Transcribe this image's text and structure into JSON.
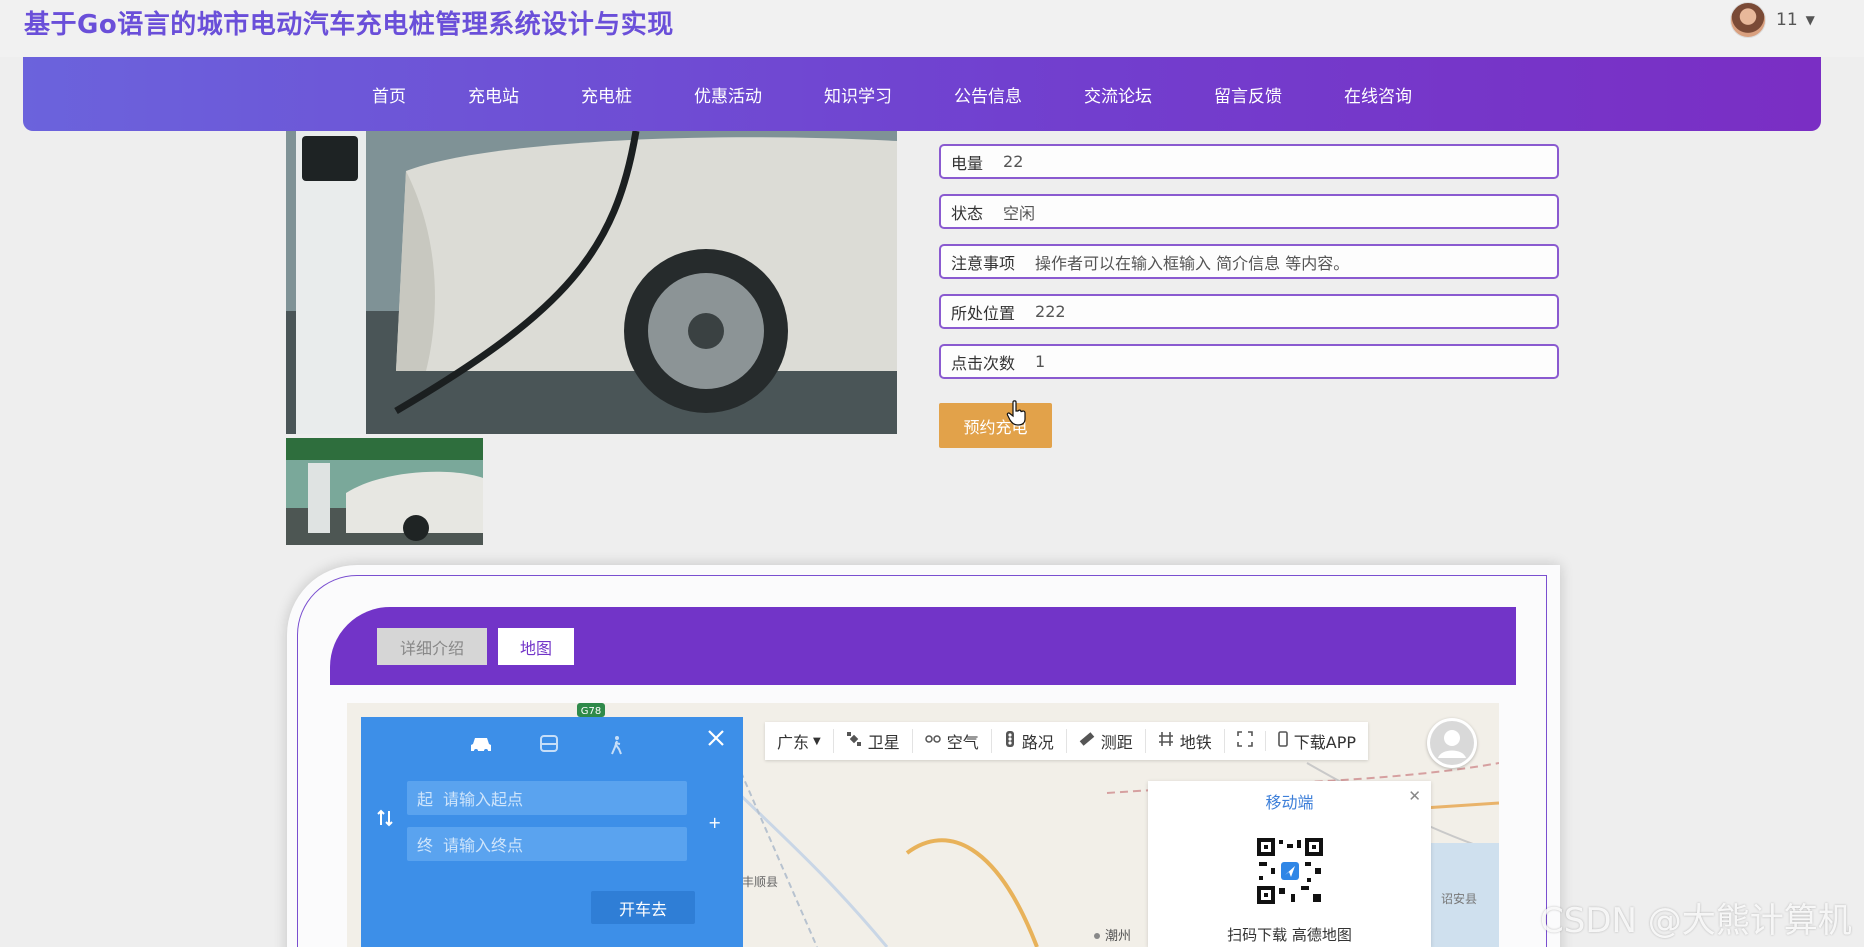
{
  "header": {
    "site_title": "基于Go语言的城市电动汽车充电桩管理系统设计与实现",
    "username": "11"
  },
  "nav": {
    "items": [
      "首页",
      "充电站",
      "充电桩",
      "优惠活动",
      "知识学习",
      "公告信息",
      "交流论坛",
      "留言反馈",
      "在线咨询"
    ]
  },
  "detail": {
    "fields": [
      {
        "label": "电量",
        "value": "22"
      },
      {
        "label": "状态",
        "value": "空闲"
      },
      {
        "label": "注意事项",
        "value": "操作者可以在输入框输入 简介信息 等内容。"
      },
      {
        "label": "所处位置",
        "value": "222"
      },
      {
        "label": "点击次数",
        "value": "1"
      }
    ],
    "reserve_label": "预约充电"
  },
  "tabs": {
    "intro": "详细介绍",
    "map": "地图"
  },
  "map": {
    "route": {
      "start_tag": "起",
      "start_placeholder": "请输入起点",
      "end_tag": "终",
      "end_placeholder": "请输入终点",
      "go_label": "开车去"
    },
    "toolbar": {
      "region": "广东",
      "satellite": "卫星",
      "air": "空气",
      "traffic": "路况",
      "measure": "测距",
      "subway": "地铁",
      "download": "下载APP"
    },
    "mobile": {
      "title": "移动端",
      "caption": "扫码下载 高德地图"
    },
    "labels": {
      "road": "G78",
      "county": "丰顺县",
      "city": "潮州",
      "east_county": "诏安县"
    }
  },
  "watermark": "CSDN @大熊计算机",
  "colors": {
    "title": "#6a4fd9",
    "nav_gradient_start": "#6b63dc",
    "nav_gradient_end": "#7a2ec4",
    "field_border": "#8a5ad0",
    "reserve_button": "#e2a24a",
    "tab_bar": "#7234c8",
    "route_panel": "#3d8fe8"
  }
}
